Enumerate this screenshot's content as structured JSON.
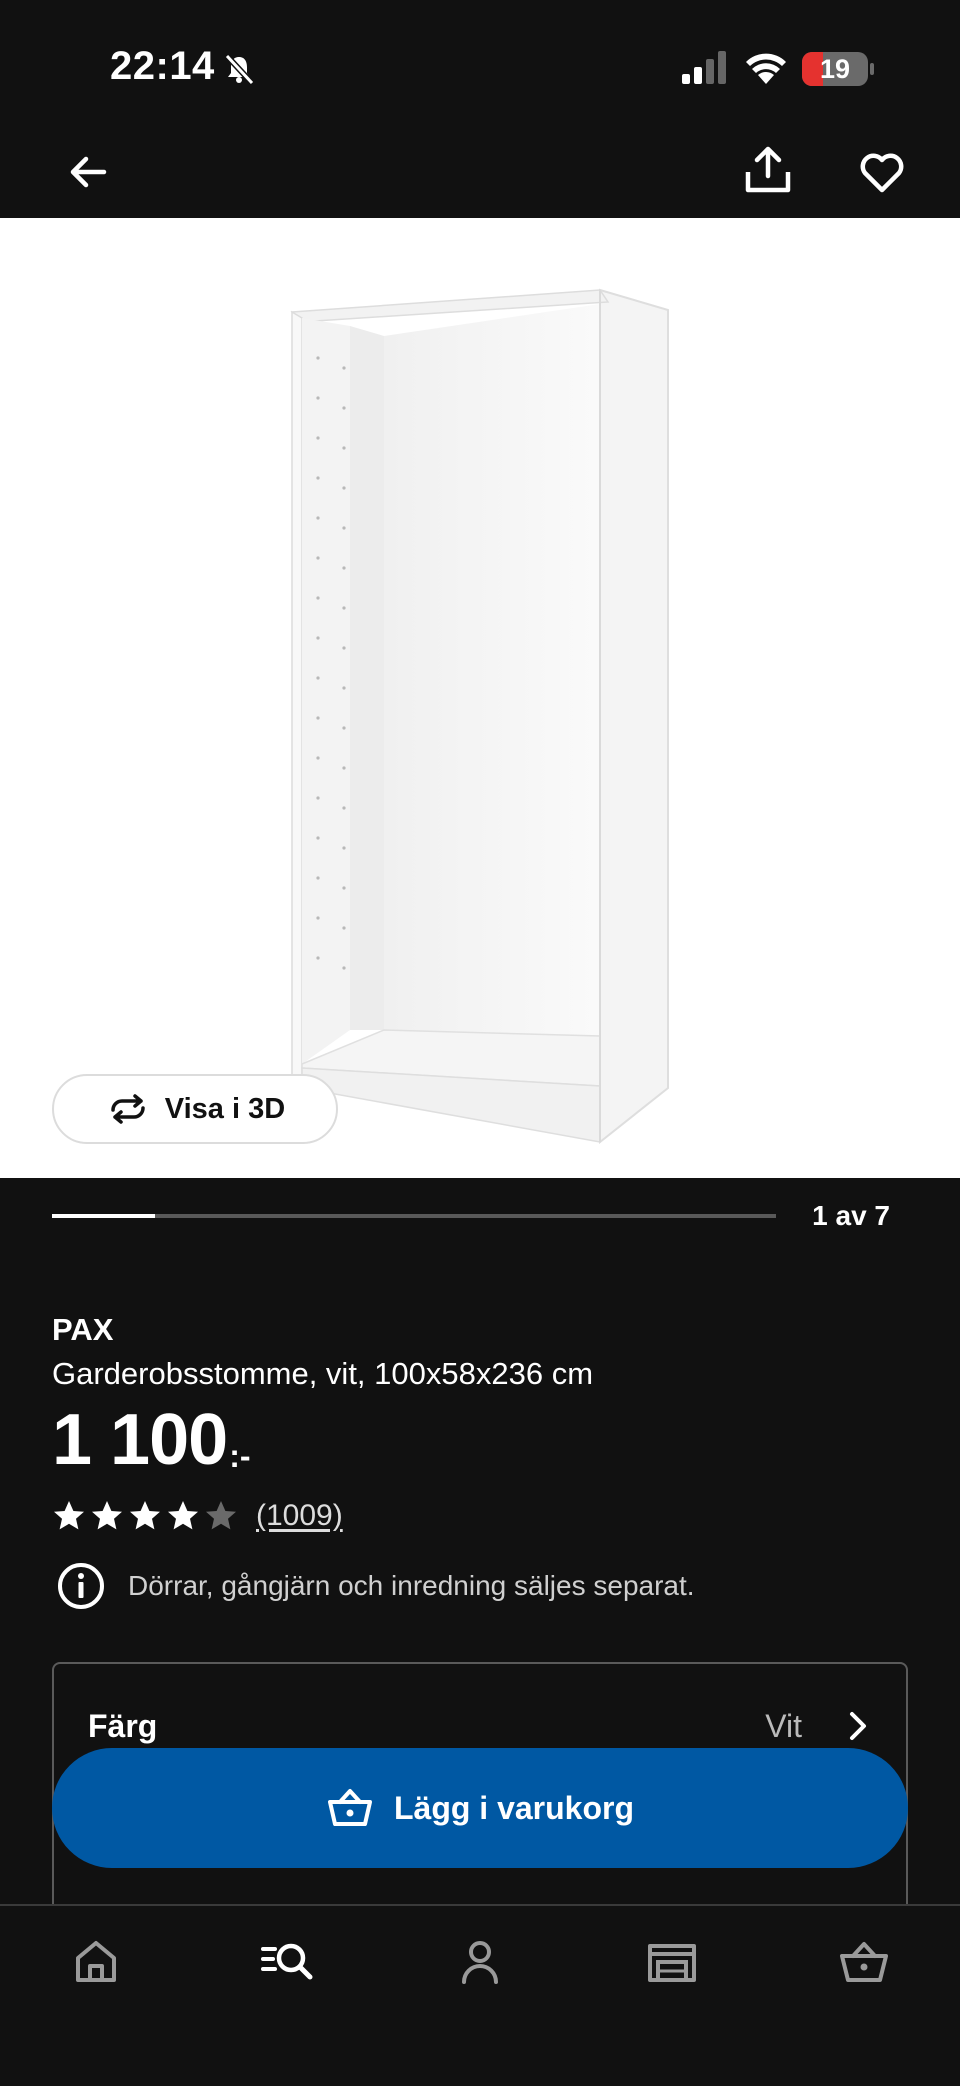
{
  "status_bar": {
    "time": "22:14",
    "battery_level": "19",
    "battery_fraction": 0.19,
    "colors": {
      "battery_low": "#e5322f"
    }
  },
  "top_nav": {
    "back_icon": "arrow-left-icon",
    "share_icon": "share-icon",
    "favorite_icon": "heart-icon"
  },
  "gallery": {
    "view_3d_label": "Visa i 3D",
    "view_3d_icon": "rotate-icon",
    "counter": "1 av 7",
    "current": 1,
    "total": 7
  },
  "product": {
    "brand": "PAX",
    "description": "Garderobsstomme, vit, 100x58x236 cm",
    "price": "1 100",
    "price_suffix": ":-",
    "rating": 4,
    "rating_max": 5,
    "review_count": "(1009)",
    "notice": "Dörrar, gångjärn och inredning säljes separat."
  },
  "options": {
    "color_label": "Färg",
    "color_value": "Vit"
  },
  "cart_button": {
    "label": "Lägg i varukorg",
    "color": "#0058a3"
  },
  "tab_bar": {
    "items": [
      "home-icon",
      "search-icon",
      "account-icon",
      "store-icon",
      "cart-icon"
    ]
  }
}
